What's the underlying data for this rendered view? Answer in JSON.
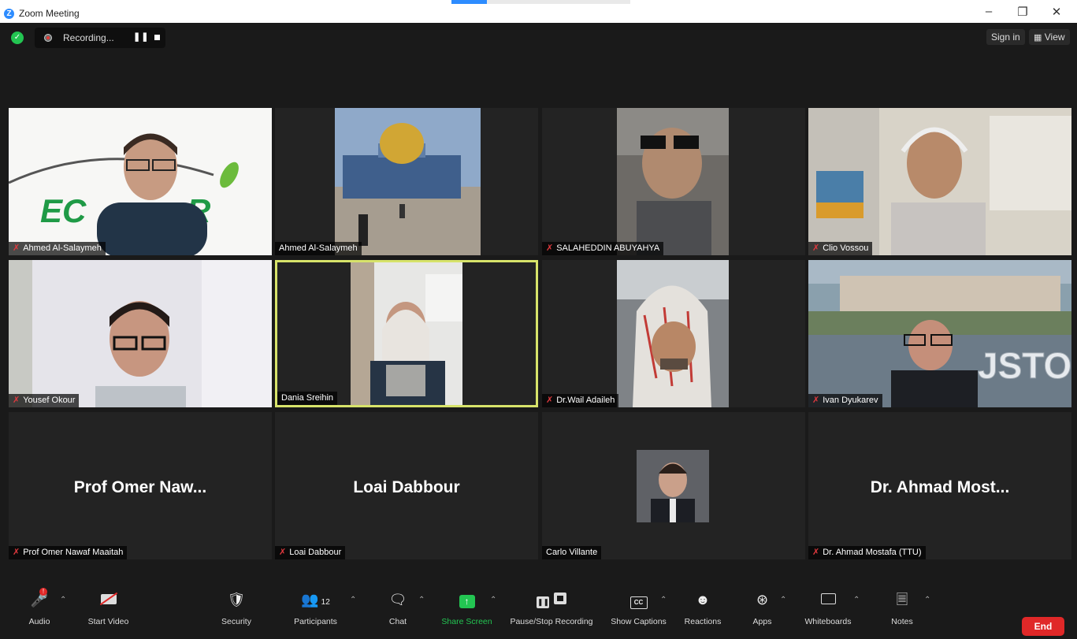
{
  "window": {
    "title": "Zoom Meeting",
    "logo_letter": "Z"
  },
  "topbar": {
    "recording_label": "Recording...",
    "sign_in_label": "Sign in",
    "view_label": "View"
  },
  "tiles": [
    {
      "name": "Ahmed Al-Salaymeh",
      "muted": true
    },
    {
      "name": "Ahmed Al-Salaymeh",
      "muted": false
    },
    {
      "name": "SALAHEDDIN ABUYAHYA",
      "muted": true
    },
    {
      "name": "Clio Vossou",
      "muted": true
    },
    {
      "name": "Yousef Okour",
      "muted": true
    },
    {
      "name": "Dania Sreihin",
      "muted": false,
      "active_speaker": true
    },
    {
      "name": "Dr.Wail Adaileh",
      "muted": true
    },
    {
      "name": "Ivan Dyukarev",
      "muted": true
    },
    {
      "name": "Prof Omer Nawaf Maaitah",
      "muted": true,
      "display": "Prof Omer Naw..."
    },
    {
      "name": "Loai Dabbour",
      "muted": true,
      "display": "Loai Dabbour"
    },
    {
      "name": "Carlo Villante",
      "muted": false
    },
    {
      "name": "Dr. Ahmad Mostafa (TTU)",
      "muted": true,
      "display": "Dr. Ahmad Most..."
    }
  ],
  "toolbar": {
    "audio": "Audio",
    "start_video": "Start Video",
    "security": "Security",
    "participants": "Participants",
    "participants_count": "12",
    "chat": "Chat",
    "share_screen": "Share Screen",
    "pause_stop_recording": "Pause/Stop Recording",
    "show_captions": "Show Captions",
    "reactions": "Reactions",
    "apps": "Apps",
    "whiteboards": "Whiteboards",
    "notes": "Notes",
    "end": "End",
    "captions_icon_text": "CC"
  },
  "colors": {
    "accent_blue": "#2d8cff",
    "share_green": "#23c552",
    "end_red": "#e02828",
    "active_speaker_outline": "#d7e36a",
    "muted_red": "#e0393e"
  }
}
